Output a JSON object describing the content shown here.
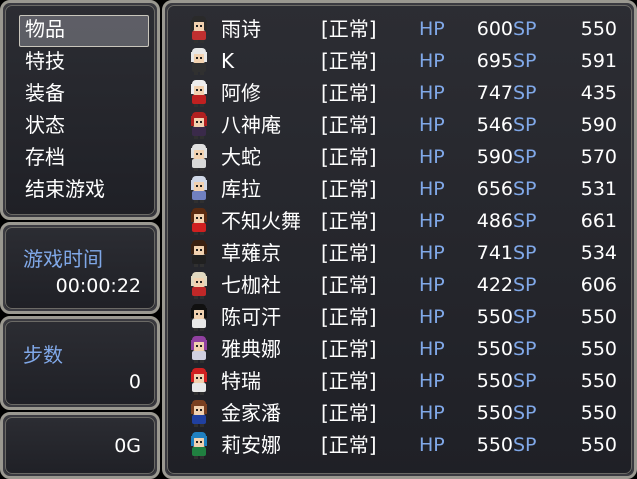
{
  "menu": {
    "items": [
      "物品",
      "特技",
      "装备",
      "状态",
      "存档",
      "结束游戏"
    ],
    "selected_index": 0
  },
  "playtime": {
    "label": "游戏时间",
    "value": "00:00:22"
  },
  "steps": {
    "label": "步数",
    "value": "0"
  },
  "gold": {
    "value": "0G"
  },
  "party": {
    "hp_label": "HP",
    "sp_label": "SP",
    "members": [
      {
        "name": "雨诗",
        "status": "[正常]",
        "hp": "600",
        "sp": "550",
        "hair": "#2a2a2a",
        "cloth": "#c03030"
      },
      {
        "name": "K",
        "status": "[正常]",
        "hp": "695",
        "sp": "591",
        "hair": "#e8e8e8",
        "cloth": "#303030"
      },
      {
        "name": "阿修",
        "status": "[正常]",
        "hp": "747",
        "sp": "435",
        "hair": "#eeeeee",
        "cloth": "#c02020"
      },
      {
        "name": "八神庵",
        "status": "[正常]",
        "hp": "546",
        "sp": "590",
        "hair": "#b02020",
        "cloth": "#3a2a4a"
      },
      {
        "name": "大蛇",
        "status": "[正常]",
        "hp": "590",
        "sp": "570",
        "hair": "#e0e0e0",
        "cloth": "#d8d8d8"
      },
      {
        "name": "库拉",
        "status": "[正常]",
        "hp": "656",
        "sp": "531",
        "hair": "#d0d8e8",
        "cloth": "#7080c0"
      },
      {
        "name": "不知火舞",
        "status": "[正常]",
        "hp": "486",
        "sp": "661",
        "hair": "#5a2a10",
        "cloth": "#d02020"
      },
      {
        "name": "草薙京",
        "status": "[正常]",
        "hp": "741",
        "sp": "534",
        "hair": "#3a2010",
        "cloth": "#202020"
      },
      {
        "name": "七枷社",
        "status": "[正常]",
        "hp": "422",
        "sp": "606",
        "hair": "#e0d8c0",
        "cloth": "#c02828"
      },
      {
        "name": "陈可汗",
        "status": "[正常]",
        "hp": "550",
        "sp": "550",
        "hair": "#101010",
        "cloth": "#e8e8e8"
      },
      {
        "name": "雅典娜",
        "status": "[正常]",
        "hp": "550",
        "sp": "550",
        "hair": "#9040a0",
        "cloth": "#d0d0e0"
      },
      {
        "name": "特瑞",
        "status": "[正常]",
        "hp": "550",
        "sp": "550",
        "hair": "#d02020",
        "cloth": "#e8e8e8"
      },
      {
        "name": "金家潘",
        "status": "[正常]",
        "hp": "550",
        "sp": "550",
        "hair": "#7a4020",
        "cloth": "#2040a0"
      },
      {
        "name": "莉安娜",
        "status": "[正常]",
        "hp": "550",
        "sp": "550",
        "hair": "#2080c0",
        "cloth": "#208040"
      }
    ]
  }
}
